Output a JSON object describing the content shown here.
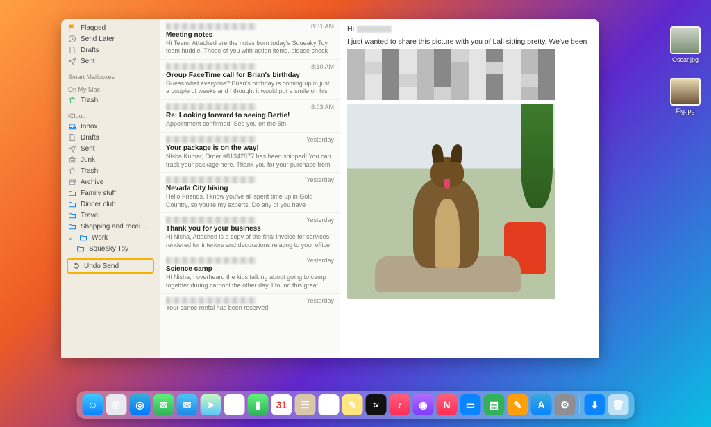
{
  "sidebar": {
    "favorites": [
      {
        "icon": "flag",
        "label": "Flagged",
        "color": "#ff9f0a"
      },
      {
        "icon": "clock",
        "label": "Send Later",
        "color": "#8e8e93"
      },
      {
        "icon": "doc",
        "label": "Drafts",
        "color": "#8e8e93"
      },
      {
        "icon": "plane",
        "label": "Sent",
        "color": "#8e8e93"
      }
    ],
    "smart_header": "Smart Mailboxes",
    "onmac_header": "On My Mac",
    "onmac": [
      {
        "icon": "trash",
        "label": "Trash",
        "color": "#30b15a"
      }
    ],
    "icloud_header": "iCloud",
    "icloud": [
      {
        "icon": "inbox",
        "label": "Inbox",
        "color": "#0a84ff"
      },
      {
        "icon": "doc",
        "label": "Drafts",
        "color": "#8e8e93"
      },
      {
        "icon": "plane",
        "label": "Sent",
        "color": "#8e8e93"
      },
      {
        "icon": "junk",
        "label": "Junk",
        "color": "#8e8e93"
      },
      {
        "icon": "trash",
        "label": "Trash",
        "color": "#8e8e93"
      },
      {
        "icon": "archive",
        "label": "Archive",
        "color": "#8e8e93"
      },
      {
        "icon": "folder",
        "label": "Family stuff",
        "color": "#0a84ff"
      },
      {
        "icon": "folder",
        "label": "Dinner club",
        "color": "#0a84ff"
      },
      {
        "icon": "folder",
        "label": "Travel",
        "color": "#0a84ff"
      },
      {
        "icon": "folder",
        "label": "Shopping and recei…",
        "color": "#0a84ff"
      },
      {
        "icon": "folder",
        "label": "Work",
        "color": "#0a84ff",
        "expanded": true
      },
      {
        "icon": "folder",
        "label": "Squeaky Toy",
        "color": "#0a84ff",
        "sub": true
      }
    ],
    "undo": {
      "icon": "undo",
      "label": "Undo Send"
    }
  },
  "messages": [
    {
      "time": "8:31 AM",
      "subject": "Meeting notes",
      "preview": "Hi Team, Attached are the notes from today's Squeaky Toy team huddle. Those of you with action items, please check the traini…"
    },
    {
      "time": "8:10 AM",
      "subject": "Group FaceTime call for Brian's birthday",
      "preview": "Guess what everyone? Brian's birthday is coming up in just a couple of weeks and I thought it would put a smile on his face i…"
    },
    {
      "time": "8:03 AM",
      "subject": "Re: Looking forward to seeing Bertie!",
      "preview": "Appointment confirmed! See you on the 5th."
    },
    {
      "time": "Yesterday",
      "subject": "Your package is on the way!",
      "preview": "Nisha Kumar, Order #81342877 has been shipped! You can track your package here. Thank you for your purchase from Polyeste…"
    },
    {
      "time": "Yesterday",
      "subject": "Nevada City hiking",
      "preview": "Hello Friends, I know you've all spent time up in Gold Country, so you're my experts. Do any of you have recommendations for g…"
    },
    {
      "time": "Yesterday",
      "subject": "Thank you for your business",
      "preview": "Hi Nisha, Attached is a copy of the final invoice for services rendered for interiors and decorations relating to your office ro…"
    },
    {
      "time": "Yesterday",
      "subject": "Science camp",
      "preview": "Hi Nisha, I overheard the kids talking about going to camp together during carpool the other day. I found this great scienc…"
    },
    {
      "time": "Yesterday",
      "subject": "",
      "preview": "Your canoe rental has been reserved!"
    }
  ],
  "reader": {
    "greeting": "Hi",
    "body": "I just wanted to share this picture with you of Lali sitting pretty. We've been"
  },
  "desktop_files": [
    {
      "name": "Oscar.jpg"
    },
    {
      "name": "Fig.jpg"
    }
  ],
  "dock": [
    {
      "name": "finder",
      "bg": "linear-gradient(#3ec7ff,#0a84ff)",
      "g": "☺"
    },
    {
      "name": "launchpad",
      "bg": "#e8e8ee",
      "g": "⊞"
    },
    {
      "name": "safari",
      "bg": "linear-gradient(#34aadc,#007aff)",
      "g": "◎"
    },
    {
      "name": "messages",
      "bg": "linear-gradient(#5ef27a,#30b15a)",
      "g": "✉"
    },
    {
      "name": "mail",
      "bg": "linear-gradient(#4fc3f7,#1e88e5)",
      "g": "✉"
    },
    {
      "name": "maps",
      "bg": "linear-gradient(#c7f5c0,#5ac8fa)",
      "g": "➤"
    },
    {
      "name": "photos",
      "bg": "#fff",
      "g": "✿"
    },
    {
      "name": "facetime",
      "bg": "linear-gradient(#5ef27a,#30b15a)",
      "g": "▮"
    },
    {
      "name": "calendar",
      "bg": "#fff",
      "g": "31",
      "text": "#e33"
    },
    {
      "name": "contacts",
      "bg": "#d9c7a9",
      "g": "☰"
    },
    {
      "name": "reminders",
      "bg": "#fff",
      "g": "☰"
    },
    {
      "name": "notes",
      "bg": "#ffe57f",
      "g": "✎"
    },
    {
      "name": "tv",
      "bg": "#111",
      "g": "tv",
      "fs": "9px"
    },
    {
      "name": "music",
      "bg": "linear-gradient(#ff5e7e,#ff2d55)",
      "g": "♪"
    },
    {
      "name": "podcasts",
      "bg": "linear-gradient(#b36bff,#7d3cff)",
      "g": "◉"
    },
    {
      "name": "news",
      "bg": "linear-gradient(#ff5e7e,#ff2d55)",
      "g": "N"
    },
    {
      "name": "keynote",
      "bg": "#0a84ff",
      "g": "▭"
    },
    {
      "name": "numbers",
      "bg": "#30b15a",
      "g": "▤"
    },
    {
      "name": "pages",
      "bg": "#ff9f0a",
      "g": "✎"
    },
    {
      "name": "appstore",
      "bg": "linear-gradient(#34aadc,#0a84ff)",
      "g": "A"
    },
    {
      "name": "settings",
      "bg": "#8e8e93",
      "g": "⚙"
    }
  ],
  "dock_right": [
    {
      "name": "downloads",
      "bg": "#0a84ff",
      "g": "⬇"
    },
    {
      "name": "trash",
      "bg": "rgba(255,255,255,.6)",
      "g": "🗑"
    }
  ]
}
